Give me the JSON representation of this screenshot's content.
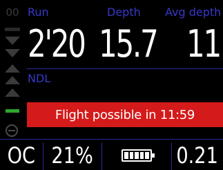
{
  "gauge": {
    "number": "00"
  },
  "headers": {
    "run": "Run",
    "depth": "Depth",
    "avg_depth": "Avg depth"
  },
  "values": {
    "run": "2'20",
    "depth": "15.7",
    "avg_depth": "11"
  },
  "ndl": {
    "label": "NDL"
  },
  "banner": {
    "text": "Flight possible in 11:59",
    "color": "#d41a1a"
  },
  "bottom": {
    "mode": "OC",
    "o2": "21%",
    "ppo2": "0.21",
    "battery_icon": "battery-icon"
  },
  "colors": {
    "label_blue": "#3737c8",
    "gauge_green": "#2ea72e"
  }
}
